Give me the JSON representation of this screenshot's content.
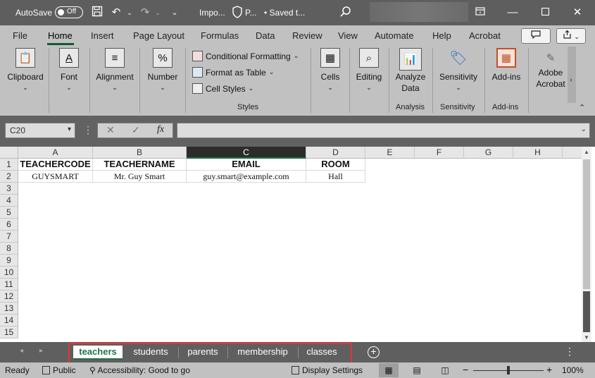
{
  "titlebar": {
    "autosave_label": "AutoSave",
    "autosave_state": "Off",
    "file_title": "Impo...",
    "sensitivity_label": "P...",
    "saved_status": "• Saved t..."
  },
  "menu_tabs": [
    "File",
    "Home",
    "Insert",
    "Page Layout",
    "Formulas",
    "Data",
    "Review",
    "View",
    "Automate",
    "Help",
    "Acrobat"
  ],
  "ribbon": {
    "clipboard": "Clipboard",
    "font": "Font",
    "alignment": "Alignment",
    "number": "Number",
    "conditional_formatting": "Conditional Formatting",
    "format_as_table": "Format as Table",
    "cell_styles": "Cell Styles",
    "styles_group": "Styles",
    "cells": "Cells",
    "editing": "Editing",
    "analyze_data_1": "Analyze",
    "analyze_data_2": "Data",
    "analysis_group": "Analysis",
    "sensitivity": "Sensitivity",
    "sensitivity_group": "Sensitivity",
    "addins": "Add-ins",
    "addins_group": "Add-ins",
    "adobe_1": "Adobe",
    "adobe_2": "Acrobat"
  },
  "formula_bar": {
    "name_box": "C20",
    "fx": "fx",
    "formula": ""
  },
  "grid": {
    "columns": [
      "A",
      "B",
      "C",
      "D",
      "E",
      "F",
      "G",
      "H"
    ],
    "rows": [
      "1",
      "2",
      "3",
      "4",
      "5",
      "6",
      "7",
      "8",
      "9",
      "10",
      "11",
      "12",
      "13",
      "14",
      "15"
    ],
    "header_row": [
      "TEACHERCODE",
      "TEACHERNAME",
      "EMAIL",
      "ROOM"
    ],
    "data_row": [
      "GUYSMART",
      "Mr. Guy Smart",
      "guy.smart@example.com",
      "Hall"
    ],
    "selected_column": "C"
  },
  "sheet_tabs": [
    "teachers",
    "students",
    "parents",
    "membership",
    "classes"
  ],
  "active_sheet": "teachers",
  "statusbar": {
    "ready": "Ready",
    "public": "Public",
    "accessibility": "Accessibility: Good to go",
    "display_settings": "Display Settings",
    "zoom": "100%"
  },
  "colors": {
    "titlebar": "#5e5e5e",
    "ribbon": "#c1c1c1",
    "excel_green": "#217346",
    "highlight": "#e8323a"
  }
}
